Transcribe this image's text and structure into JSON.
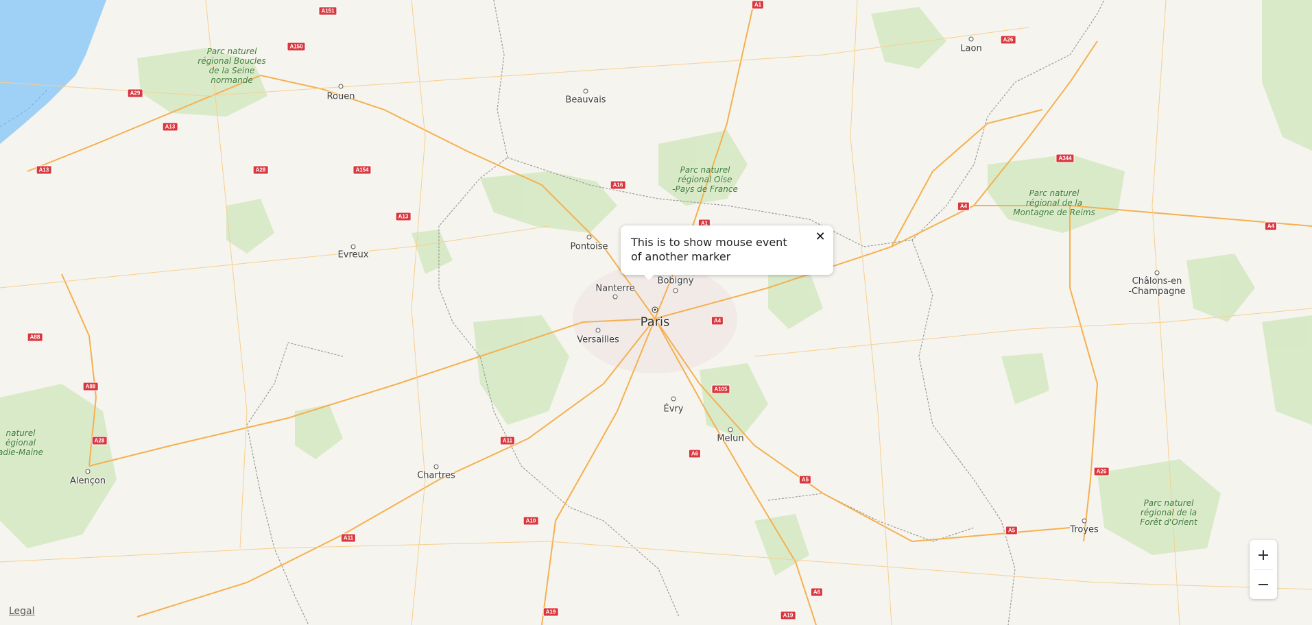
{
  "map": {
    "places": [
      {
        "name": "Laon",
        "type": "city"
      },
      {
        "name": "Rouen",
        "type": "city"
      },
      {
        "name": "Beauvais",
        "type": "city"
      },
      {
        "name": "Pontoise",
        "type": "city"
      },
      {
        "name": "Evreux",
        "type": "city"
      },
      {
        "name": "Nanterre",
        "type": "city"
      },
      {
        "name": "Bobigny",
        "type": "city"
      },
      {
        "name": "Paris",
        "type": "capital"
      },
      {
        "name": "Versailles",
        "type": "city"
      },
      {
        "name": "Évry",
        "type": "city"
      },
      {
        "name": "Melun",
        "type": "city"
      },
      {
        "name": "Chartres",
        "type": "city"
      },
      {
        "name": "Alençon",
        "type": "city"
      },
      {
        "name": "Châlons-en\n-Champagne",
        "type": "city"
      },
      {
        "name": "Troyes",
        "type": "city"
      }
    ],
    "parks": [
      "Parc naturel\nrégional Boucles\nde la Seine\nnormande",
      "Parc naturel\nrégional Oise\n-Pays de France",
      "Parc naturel\nrégional de la\nMontagne de Reims",
      "naturel\négional\nadie-Maine",
      "Parc naturel\nrégional de la\nForêt d'Orient"
    ],
    "road_shields": [
      "A151",
      "A1",
      "A26",
      "A150",
      "A29",
      "A13",
      "A13",
      "A28",
      "A154",
      "A13",
      "A16",
      "A1",
      "A344",
      "A4",
      "A4",
      "A4",
      "A88",
      "A88",
      "A105",
      "A28",
      "A11",
      "A6",
      "A5",
      "A26",
      "A10",
      "A11",
      "A5",
      "A6",
      "A19",
      "A19"
    ]
  },
  "callout": {
    "text": "This is to show mouse event of another marker",
    "close_icon": "close-icon"
  },
  "controls": {
    "zoom_in_icon": "plus-icon",
    "zoom_out_icon": "minus-icon",
    "legal_label": "Legal"
  },
  "colors": {
    "land": "#f6f4ee",
    "water": "#9fd0f5",
    "park": "#d7e9c6",
    "road": "#f5b04f",
    "shield": "#d9363e",
    "border": "#9a9a9a"
  }
}
